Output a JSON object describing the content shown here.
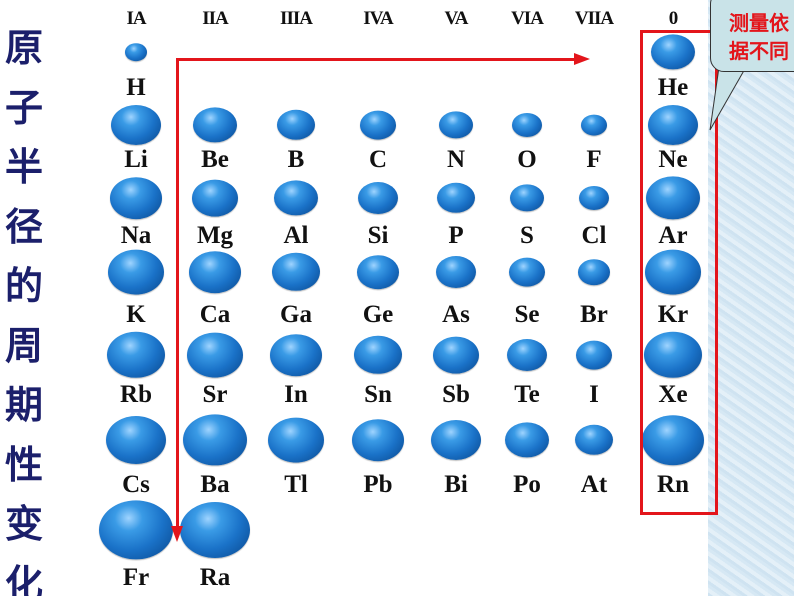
{
  "title_chars": [
    "原",
    "子",
    "半",
    "径",
    "的",
    "周",
    "期",
    "性",
    "变",
    "化"
  ],
  "groups": [
    "IA",
    "IIA",
    "IIIA",
    "IVA",
    "VA",
    "VIA",
    "VIIA",
    "0"
  ],
  "elements": [
    {
      "symbol": "H",
      "group": 0,
      "period": 1
    },
    {
      "symbol": "He",
      "group": 7,
      "period": 1
    },
    {
      "symbol": "Li",
      "group": 0,
      "period": 2
    },
    {
      "symbol": "Be",
      "group": 1,
      "period": 2
    },
    {
      "symbol": "B",
      "group": 2,
      "period": 2
    },
    {
      "symbol": "C",
      "group": 3,
      "period": 2
    },
    {
      "symbol": "N",
      "group": 4,
      "period": 2
    },
    {
      "symbol": "O",
      "group": 5,
      "period": 2
    },
    {
      "symbol": "F",
      "group": 6,
      "period": 2
    },
    {
      "symbol": "Ne",
      "group": 7,
      "period": 2
    },
    {
      "symbol": "Na",
      "group": 0,
      "period": 3
    },
    {
      "symbol": "Mg",
      "group": 1,
      "period": 3
    },
    {
      "symbol": "Al",
      "group": 2,
      "period": 3
    },
    {
      "symbol": "Si",
      "group": 3,
      "period": 3
    },
    {
      "symbol": "P",
      "group": 4,
      "period": 3
    },
    {
      "symbol": "S",
      "group": 5,
      "period": 3
    },
    {
      "symbol": "Cl",
      "group": 6,
      "period": 3
    },
    {
      "symbol": "Ar",
      "group": 7,
      "period": 3
    },
    {
      "symbol": "K",
      "group": 0,
      "period": 4
    },
    {
      "symbol": "Ca",
      "group": 1,
      "period": 4
    },
    {
      "symbol": "Ga",
      "group": 2,
      "period": 4
    },
    {
      "symbol": "Ge",
      "group": 3,
      "period": 4
    },
    {
      "symbol": "As",
      "group": 4,
      "period": 4
    },
    {
      "symbol": "Se",
      "group": 5,
      "period": 4
    },
    {
      "symbol": "Br",
      "group": 6,
      "period": 4
    },
    {
      "symbol": "Kr",
      "group": 7,
      "period": 4
    },
    {
      "symbol": "Rb",
      "group": 0,
      "period": 5
    },
    {
      "symbol": "Sr",
      "group": 1,
      "period": 5
    },
    {
      "symbol": "In",
      "group": 2,
      "period": 5
    },
    {
      "symbol": "Sn",
      "group": 3,
      "period": 5
    },
    {
      "symbol": "Sb",
      "group": 4,
      "period": 5
    },
    {
      "symbol": "Te",
      "group": 5,
      "period": 5
    },
    {
      "symbol": "I",
      "group": 6,
      "period": 5
    },
    {
      "symbol": "Xe",
      "group": 7,
      "period": 5
    },
    {
      "symbol": "Cs",
      "group": 0,
      "period": 6
    },
    {
      "symbol": "Ba",
      "group": 1,
      "period": 6
    },
    {
      "symbol": "Tl",
      "group": 2,
      "period": 6
    },
    {
      "symbol": "Pb",
      "group": 3,
      "period": 6
    },
    {
      "symbol": "Bi",
      "group": 4,
      "period": 6
    },
    {
      "symbol": "Po",
      "group": 5,
      "period": 6
    },
    {
      "symbol": "At",
      "group": 6,
      "period": 6
    },
    {
      "symbol": "Rn",
      "group": 7,
      "period": 6
    },
    {
      "symbol": "Fr",
      "group": 0,
      "period": 7
    },
    {
      "symbol": "Ra",
      "group": 1,
      "period": 7
    }
  ],
  "callout": {
    "line1": "测量依",
    "line2": "据不同"
  },
  "colors": {
    "accent": "#e3151b",
    "sphere": "#1a72c8",
    "title": "#1b1f6b"
  }
}
